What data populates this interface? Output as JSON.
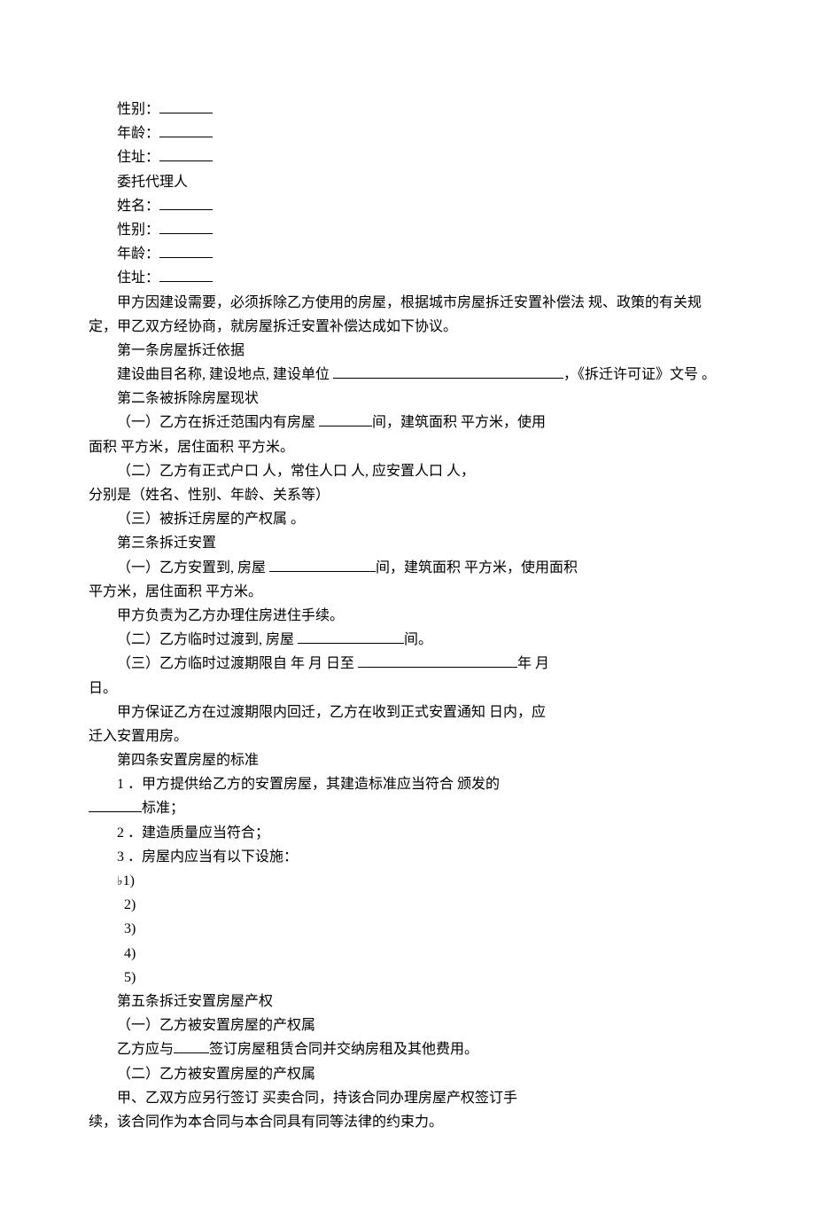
{
  "person": {
    "gender_label": "性别：",
    "age_label": "年龄：",
    "address_label": "住址：",
    "agent_label": "委托代理人",
    "name_label": "姓名："
  },
  "preamble": {
    "p1": "甲方因建设需要，必须拆除乙方使用的房屋，根据城市房屋拆迁安置补偿法 规、政策的有关规定，甲乙双方经协商，就房屋拆迁安置补偿达成如下协议。"
  },
  "article1": {
    "title": "第一条房屋拆迁依据",
    "content_a": "建设曲目名称, 建设地点, 建设单位 ",
    "content_b": "，《拆迁许可证》文号 。"
  },
  "article2": {
    "title": "第二条被拆除房屋现状",
    "item1_a": "（一）乙方在拆迁范围内有房屋 ",
    "item1_b": "间，建筑面积 平方米，使用",
    "item1_c": "面积 平方米，居住面积 平方米。",
    "item2": "（二）乙方有正式户口 人，常住人口 人, 应安置人口 人，",
    "item2_b": "分别是（姓名、性别、年龄、关系等）",
    "item3": "（三）被拆迁房屋的产权属 。"
  },
  "article3": {
    "title": "第三条拆迁安置",
    "item1_a": "（一）乙方安置到, 房屋 ",
    "item1_b": "间，建筑面积 平方米，使用面积 ",
    "item1_c": "平方米，居住面积 平方米。",
    "item1_d": "甲方负责为乙方办理住房进住手续。",
    "item2_a": "（二）乙方临时过渡到, 房屋 ",
    "item2_b": "间。",
    "item3_a": "（三）乙方临时过渡期限自  年 月 日至 ",
    "item3_b": "年 月",
    "item3_c": "日。",
    "item3_d": "甲方保证乙方在过渡期限内回迁，乙方在收到正式安置通知 日内，应",
    "item3_e": "迁入安置用房。"
  },
  "article4": {
    "title": "第四条安置房屋的标准",
    "item1_a": "1 ．甲方提供给乙方的安置房屋，其建造标准应当符合 颁发的",
    "item1_b": "标准；",
    "item2": "2 ．建造质量应当符合；",
    "item3": "3 ．房屋内应当有以下设施：",
    "sub1": "1)",
    "sub2": "2)",
    "sub3": "3)",
    "sub4": "4)",
    "sub5": "5)"
  },
  "article5": {
    "title": "第五条拆迁安置房屋产权",
    "item1": "（一）乙方被安置房屋的产权属",
    "item1_b_pre": "乙方应与",
    "item1_b_post": "签订房屋租赁合同并交纳房租及其他费用。",
    "item2": "（二）乙方被安置房屋的产权属",
    "item2_b": "甲、乙双方应另行签订 买卖合同，持该合同办理房屋产权签订手",
    "item2_c": "续，该合同作为本合同与本合同具有同等法律的约束力。"
  }
}
